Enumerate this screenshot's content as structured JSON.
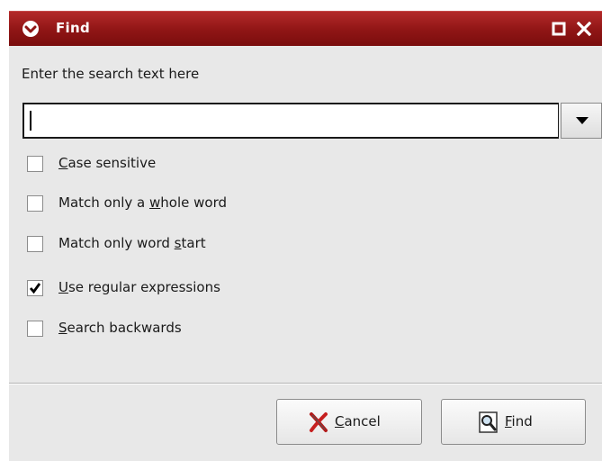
{
  "window": {
    "title": "Find"
  },
  "prompt": "Enter the search text here",
  "search": {
    "value": "",
    "placeholder": ""
  },
  "options": [
    {
      "mnemonic": "C",
      "rest": "ase sensitive",
      "prefix": "",
      "checked": false
    },
    {
      "prefix": "Match only a ",
      "mnemonic": "w",
      "rest": "hole word",
      "checked": false
    },
    {
      "prefix": "Match only word ",
      "mnemonic": "s",
      "rest": "tart",
      "checked": false
    },
    {
      "prefix": "",
      "mnemonic": "U",
      "rest": "se regular expressions",
      "checked": true
    },
    {
      "prefix": "",
      "mnemonic": "S",
      "rest": "earch backwards",
      "checked": false
    }
  ],
  "buttons": {
    "cancel": {
      "mnemonic": "C",
      "rest": "ancel",
      "icon": "cancel-x-icon"
    },
    "find": {
      "mnemonic": "F",
      "rest": "ind",
      "icon": "magnifier-icon"
    }
  },
  "colors": {
    "titlebar": "#8f1515",
    "window_bg": "#e8e8e8"
  }
}
